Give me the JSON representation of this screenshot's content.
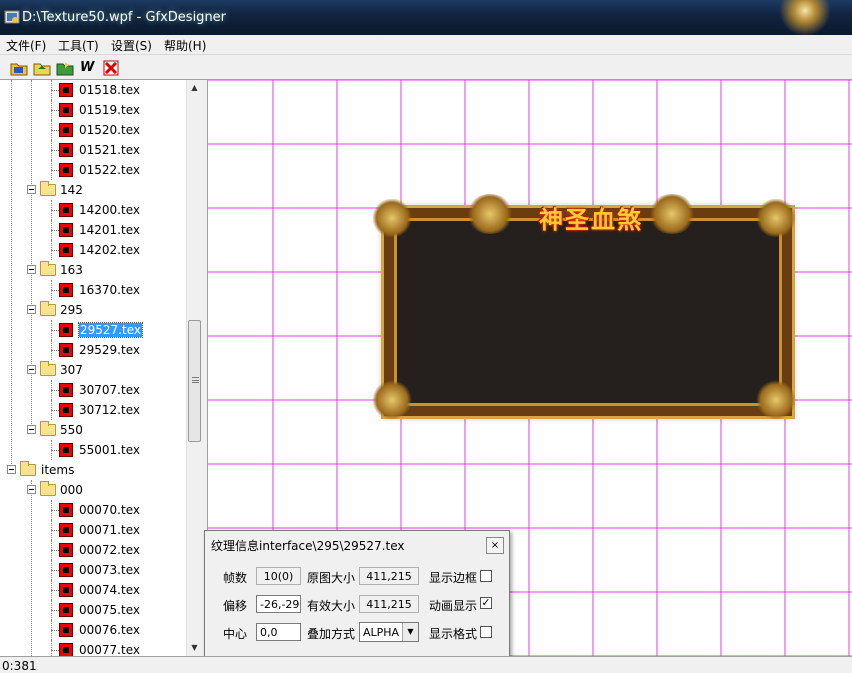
{
  "window": {
    "title": "D:\\Texture50.wpf - GfxDesigner"
  },
  "menu": {
    "items": [
      "文件(F)",
      "工具(T)",
      "设置(S)",
      "帮助(H)"
    ]
  },
  "toolbar": {
    "buttons": [
      "open-folder-icon",
      "folder-load-icon",
      "folder-export-icon",
      "w-tool-icon",
      "delete-icon"
    ],
    "w_label": "W"
  },
  "tree": {
    "rows": [
      {
        "label": "01518.tex",
        "type": "tex"
      },
      {
        "label": "01519.tex",
        "type": "tex"
      },
      {
        "label": "01520.tex",
        "type": "tex"
      },
      {
        "label": "01521.tex",
        "type": "tex"
      },
      {
        "label": "01522.tex",
        "type": "tex"
      },
      {
        "label": "142",
        "type": "folder"
      },
      {
        "label": "14200.tex",
        "type": "tex"
      },
      {
        "label": "14201.tex",
        "type": "tex"
      },
      {
        "label": "14202.tex",
        "type": "tex"
      },
      {
        "label": "163",
        "type": "folder"
      },
      {
        "label": "16370.tex",
        "type": "tex"
      },
      {
        "label": "295",
        "type": "folder"
      },
      {
        "label": "29527.tex",
        "type": "tex",
        "selected": true
      },
      {
        "label": "29529.tex",
        "type": "tex"
      },
      {
        "label": "307",
        "type": "folder"
      },
      {
        "label": "30707.tex",
        "type": "tex"
      },
      {
        "label": "30712.tex",
        "type": "tex"
      },
      {
        "label": "550",
        "type": "folder"
      },
      {
        "label": "55001.tex",
        "type": "tex"
      },
      {
        "label": "items",
        "type": "rootfolder"
      },
      {
        "label": "000",
        "type": "folder"
      },
      {
        "label": "00070.tex",
        "type": "tex"
      },
      {
        "label": "00071.tex",
        "type": "tex"
      },
      {
        "label": "00072.tex",
        "type": "tex"
      },
      {
        "label": "00073.tex",
        "type": "tex"
      },
      {
        "label": "00074.tex",
        "type": "tex"
      },
      {
        "label": "00075.tex",
        "type": "tex"
      },
      {
        "label": "00076.tex",
        "type": "tex"
      },
      {
        "label": "00077.tex",
        "type": "tex"
      }
    ]
  },
  "canvas": {
    "grid_color": "#e040e0",
    "texture_title": "神圣血煞"
  },
  "dialog": {
    "title": "纹理信息interface\\295\\29527.tex",
    "close": "×",
    "frames_label": "帧数",
    "frames_value": "10(0)",
    "orig_size_label": "原图大小",
    "orig_size_value": "411,215",
    "show_border_label": "显示边框",
    "offset_label": "偏移",
    "offset_value": "-26,-29",
    "valid_size_label": "有效大小",
    "valid_size_value": "411,215",
    "animate_label": "动画显示",
    "animate_checked": "✓",
    "center_label": "中心",
    "center_value": "0,0",
    "blend_label": "叠加方式",
    "blend_value": "ALPHA",
    "show_grid_label": "显示格式"
  },
  "status": {
    "text": "0:381"
  }
}
